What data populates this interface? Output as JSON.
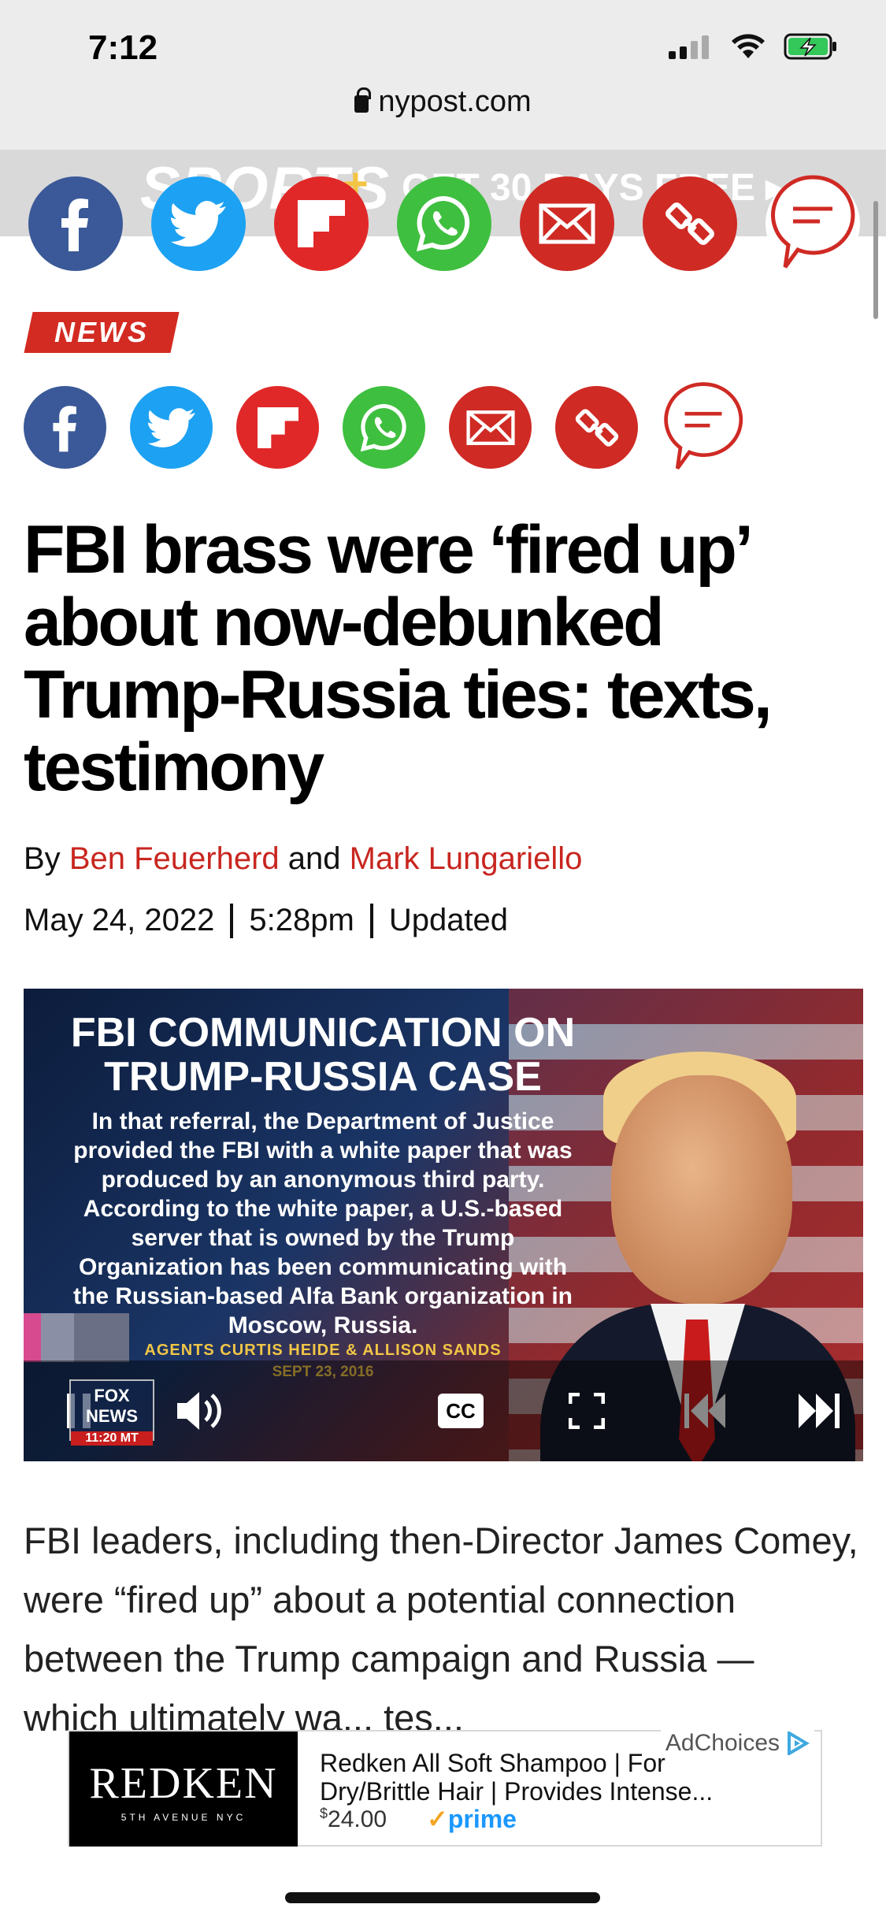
{
  "status_bar": {
    "time": "7:12"
  },
  "browser": {
    "url": "nypost.com"
  },
  "sports_banner": {
    "brand": "SPORTS",
    "plus": "+",
    "cta": "GET 30 DAYS FREE ▸"
  },
  "section_tag": "NEWS",
  "share_icons": [
    "facebook-icon",
    "twitter-icon",
    "flipboard-icon",
    "whatsapp-icon",
    "email-icon",
    "link-icon",
    "comment-icon"
  ],
  "article": {
    "headline": "FBI brass were ‘fired up’ about now-debunked Trump-Russia ties: texts, testimony",
    "by_prefix": "By",
    "author1": "Ben Feuerherd",
    "and": "and",
    "author2": "Mark Lungariello",
    "date": "May 24, 2022",
    "time": "5:28pm",
    "updated": "Updated",
    "body": "FBI leaders, including then-Director James Comey, were “fired up” about a potential connection between the Trump campaign and Russia — which ultimately wa... tes..."
  },
  "video": {
    "title": "FBI COMMUNICATION ON TRUMP-RUSSIA CASE",
    "body": "In that referral, the Department of Justice provided the FBI with a white paper that was produced by an anonymous third party. According to the white paper, a U.S.-based server that is owned by the Trump Organization has been communicating with the Russian-based Alfa Bank organization in Moscow, Russia.",
    "agents": "AGENTS CURTIS HEIDE & ALLISON SANDS",
    "date": "SEPT 23, 2016",
    "network": "FOX NEWS",
    "network_time": "11:20 MT",
    "cc_label": "CC"
  },
  "ad": {
    "brand": "REDKEN",
    "brand_sub": "5TH AVENUE NYC",
    "title": "Redken All Soft Shampoo | For Dry/Brittle Hair | Provides Intense...",
    "currency": "$",
    "price": "24.00",
    "prime": "prime",
    "adchoices": "AdChoices"
  },
  "colors": {
    "accent_red": "#d32a22",
    "facebook": "#3b5998",
    "twitter": "#1da1f2",
    "whatsapp": "#3fbf3f"
  }
}
